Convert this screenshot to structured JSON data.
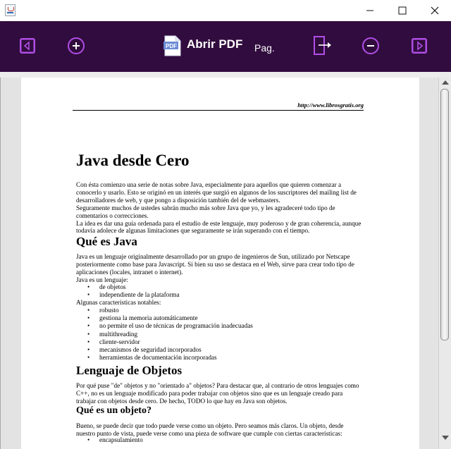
{
  "toolbar": {
    "open_pdf_label": "Abrir PDF",
    "page_label": "Pag.",
    "accent_color": "#b04fe6",
    "background_color": "#310c3e",
    "icons": [
      "previous-page-icon",
      "zoom-in-icon",
      "pdf-file-icon",
      "go-to-page-icon",
      "zoom-out-icon",
      "next-page-icon"
    ]
  },
  "pdf_icon_text": "PDF",
  "document": {
    "header_url": "http://www.librosgratis.org",
    "title": "Java desde Cero",
    "intro": [
      "Con ésta comienzo una serie de notas sobre Java, especialmente para aquellos que quieren comenzar a",
      "conocerlo y usarlo. Esto se originó en un interés que surgió en algunos de los suscriptores del mailing list de",
      "desarrolladores de web, y que pongo a disposición también del de webmasters.",
      "Seguramente muchos de ustedes sabrán mucho más sobre Java que yo, y les agradeceré todo tipo de",
      "comentarios o correcciones.",
      "La idea es dar una guía ordenada para el estudio de este lenguaje, muy poderoso y de gran coherencia, aunque",
      "todavía adolece de algunas limitaciones que seguramente se irán superando con el tiempo."
    ],
    "section1_title": "Qué es Java",
    "section1_text": [
      "Java es un lenguaje originalmente desarrollado por un grupo de ingenieros de Sun, utilizado por Netscape",
      "posteriormente como base para Javascript. Si bien su uso se destaca en el Web, sirve para crear todo tipo de",
      "aplicaciones (locales, intranet o internet).",
      "Java es un lenguaje:"
    ],
    "language_list": [
      "de objetos",
      "independiente de la plataforma"
    ],
    "features_label": "Algunas características notables:",
    "features_list": [
      "robusto",
      "gestiona la memoria automáticamente",
      "no permite el uso de técnicas de programación inadecuadas",
      "multithreading",
      "cliente-servidor",
      "mecanismos de seguridad incorporados",
      "herramientas de documentación incorporadas"
    ],
    "section2_title": "Lenguaje de Objetos",
    "section2_text": [
      "Por qué puse \"de\" objetos y no \"orientado a\" objetos? Para destacar que, al contrario de otros lenguajes como",
      "C++, no es un lenguaje modificado para poder trabajar con objetos sino que es un lenguaje creado para",
      "trabajar con objetos desde cero. De hecho, TODO lo que hay en Java son objetos."
    ],
    "section3_title": "Qué es un objeto?",
    "section3_text": [
      "Bueno, se puede decir que todo puede verse como un objeto. Pero seamos más claros. Un objeto, desde",
      "nuestro punto de vista, puede verse como una pieza de software que cumple con ciertas características:"
    ],
    "object_traits": [
      "encapsulamiento"
    ]
  }
}
